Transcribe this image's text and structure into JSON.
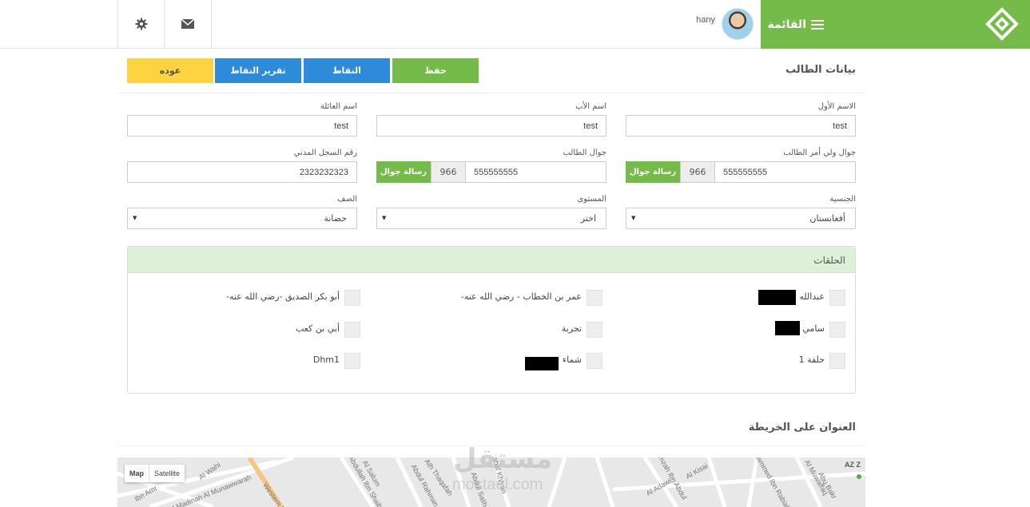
{
  "header": {
    "menu_label": "القائمة",
    "user_name": "hany",
    "brand_color": "#74bb4a"
  },
  "icons": {
    "settings": "gear-icon",
    "mail": "envelope-icon",
    "menu": "hamburger-icon"
  },
  "page": {
    "title": "بيانات الطالب",
    "buttons": {
      "save": "حفظ",
      "points": "النقاط",
      "points_report": "تقرير النقاط",
      "back": "عوده"
    }
  },
  "form": {
    "first_name_label": "الاسم الأول",
    "first_name_value": "test",
    "father_name_label": "اسم الأب",
    "father_name_value": "test",
    "family_name_label": "اسم العائلة",
    "family_name_value": "test",
    "guardian_mobile_label": "جوال ولي أمر الطالب",
    "guardian_mobile_value": "555555555",
    "guardian_prefix": "966",
    "guardian_sms": "رسالة جوال",
    "student_mobile_label": "جوال الطالب",
    "student_mobile_value": "555555555",
    "student_prefix": "966",
    "student_sms": "رسالة جوال",
    "civil_id_label": "رقم السجل المدني",
    "civil_id_value": "2323232323",
    "nationality_label": "الجنسية",
    "nationality_value": "أفغانستان",
    "level_label": "المستوى",
    "level_value": "اختر",
    "class_label": "الصف",
    "class_value": "حضانة"
  },
  "circles": {
    "title": "الحلقات",
    "items": [
      "عبدالله",
      "عمر بن الخطاب - رضي الله عنه-",
      "أبو بكر الصديق -رضي الله عنه-",
      "سامي",
      "تجربة",
      "أبي بن كعب",
      "حلقة 1",
      "شماء",
      "Dhm1"
    ]
  },
  "map": {
    "title": "العنوان على الخريطة",
    "tab_map": "Map",
    "tab_satellite": "Satellite",
    "roads": [
      "Al Wahi",
      "Al Madinah Al Munawwarah",
      "Western R",
      "Ibn Amr",
      "Al Salum",
      "Abdullah Ibn Shaibah",
      "Abdul Rahman",
      "Ath Thaqafah",
      "Jabal Khiyan",
      "Abdul Salih",
      "Al Adawi",
      "Hamzah Ibn Abdul",
      "Al Kisai",
      "Mohammed Ibn Rabiah",
      "Al Muwaffaq",
      "Abu Bakr",
      "AZ Z"
    ]
  },
  "watermark": {
    "line1": "مستقل",
    "line2": "mostaql.com"
  }
}
